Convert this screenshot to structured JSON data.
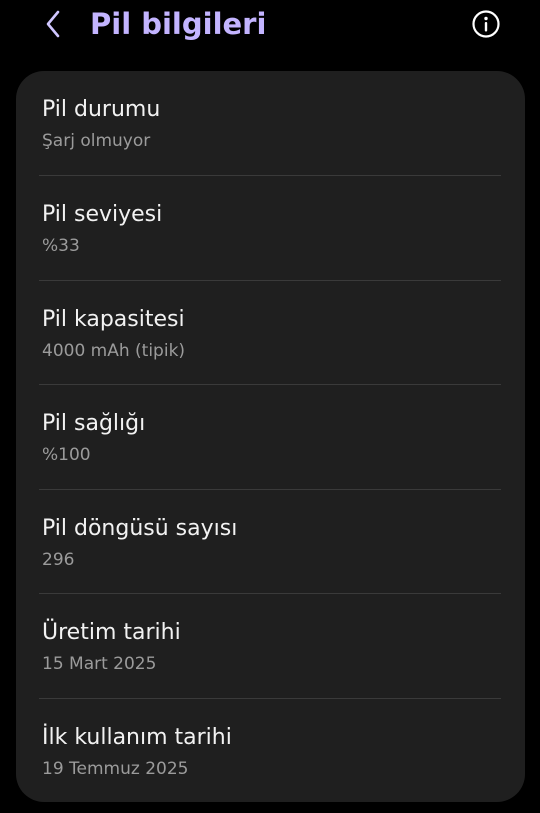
{
  "header": {
    "title": "Pil bilgileri",
    "back_icon": "chevron-left-icon",
    "info_icon": "info-circle-icon",
    "title_color": "#c3b4ff"
  },
  "items": [
    {
      "label": "Pil durumu",
      "value": "Şarj olmuyor"
    },
    {
      "label": "Pil seviyesi",
      "value": "%33"
    },
    {
      "label": "Pil kapasitesi",
      "value": "4000 mAh (tipik)"
    },
    {
      "label": "Pil sağlığı",
      "value": "%100"
    },
    {
      "label": "Pil döngüsü sayısı",
      "value": "296"
    },
    {
      "label": "Üretim tarihi",
      "value": "15 Mart 2025"
    },
    {
      "label": "İlk kullanım tarihi",
      "value": "19 Temmuz 2025"
    }
  ]
}
